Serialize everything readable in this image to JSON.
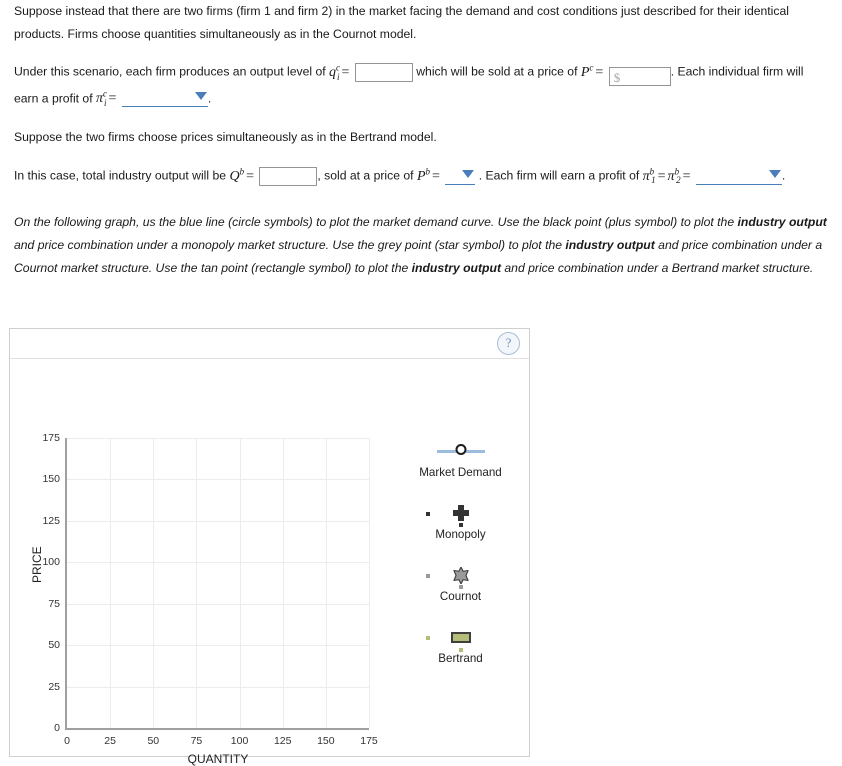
{
  "intro": {
    "text": "Suppose instead that there are two firms (firm 1 and firm 2) in the market facing the demand and cost conditions just described for their identical products. Firms choose quantities simultaneously as in the Cournot model."
  },
  "cournot": {
    "lead": "Under this scenario, each firm produces an output level of",
    "qty_var": "q",
    "qty_sup": "c",
    "qty_sub": "i",
    "equals": "=",
    "qty_value": "",
    "qty_placeholder": "",
    "mid": "which will be sold at a price of",
    "price_var": "P",
    "price_sup": "c",
    "price_value": "",
    "price_placeholder": "$",
    "after_price": ". Each individual firm will",
    "profit_lead": "earn a profit of",
    "profit_var": "π",
    "profit_sup": "c",
    "profit_sub": "i",
    "profit_selected": "",
    "period": "."
  },
  "bertrand_intro": {
    "text": "Suppose the two firms choose prices simultaneously as in the Bertrand model."
  },
  "bertrand": {
    "lead": "In this case, total industry output will be",
    "q_var": "Q",
    "q_sup": "b",
    "equals": "=",
    "q_value": "",
    "mid": ", sold at a price of",
    "price_var": "P",
    "price_sup": "b",
    "price_selected": "",
    "after_price": ". Each firm will earn a profit of",
    "profit_var1": "π",
    "profit_sup1": "b",
    "profit_sub1": "1",
    "profit_var2": "π",
    "profit_sup2": "b",
    "profit_sub2": "2",
    "profit_selected": "",
    "period": "."
  },
  "graph_instructions": {
    "part1": "On the following graph, us the blue line (circle symbols) to plot the market demand curve. Use the black point (plus symbol) to plot the ",
    "bold1": "industry output",
    "part2": " and price combination under a monopoly market structure. Use the grey point (star symbol) to plot the ",
    "bold2": "industry output",
    "part3": " and price combination under a Cournot market structure. Use the tan point (rectangle symbol) to plot the ",
    "bold3": "industry output",
    "part4": " and price combination under a Bertrand market structure."
  },
  "panel": {
    "help_label": "?"
  },
  "chart_data": {
    "type": "scatter",
    "title": "",
    "xlabel": "QUANTITY",
    "ylabel": "PRICE",
    "xlim": [
      0,
      175
    ],
    "ylim": [
      0,
      175
    ],
    "xticks": [
      0,
      25,
      50,
      75,
      100,
      125,
      150,
      175
    ],
    "yticks": [
      0,
      25,
      50,
      75,
      100,
      125,
      150,
      175
    ],
    "grid": true,
    "legend_position": "right",
    "series": [
      {
        "name": "Market Demand",
        "symbol": "circle-line",
        "color": "#9dbbdd",
        "values": []
      },
      {
        "name": "Monopoly",
        "symbol": "plus",
        "color": "#333333",
        "values": []
      },
      {
        "name": "Cournot",
        "symbol": "star",
        "color": "#9a9a9a",
        "values": []
      },
      {
        "name": "Bertrand",
        "symbol": "rectangle",
        "color": "#b5bd79",
        "values": []
      }
    ]
  },
  "colors": {
    "accent_blue": "#4a7ebb",
    "demand_blue": "#9dbbdd",
    "monopoly_black": "#333333",
    "cournot_grey": "#9a9a9a",
    "bertrand_tan": "#b5bd79"
  }
}
